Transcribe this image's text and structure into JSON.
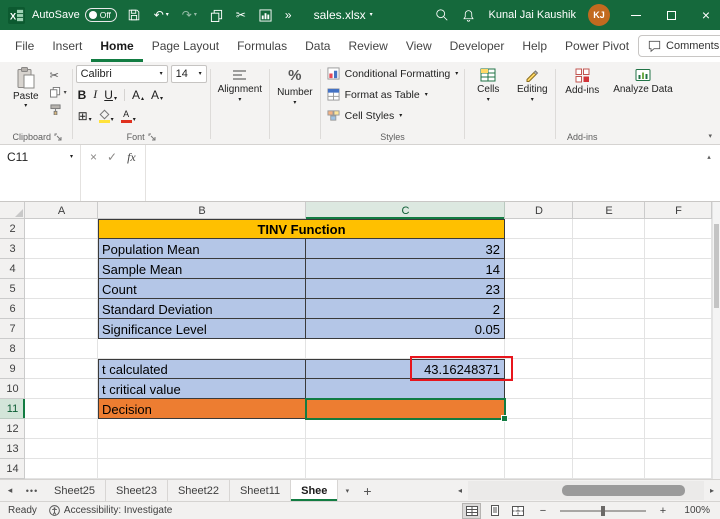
{
  "title_bar": {
    "autosave_label": "AutoSave",
    "autosave_state": "Off",
    "filename": "sales.xlsx",
    "user_name": "Kunal Jai Kaushik",
    "user_initials": "KJ"
  },
  "menu_bar": {
    "tabs": [
      {
        "label": "File",
        "active": false
      },
      {
        "label": "Insert",
        "active": false
      },
      {
        "label": "Home",
        "active": true
      },
      {
        "label": "Page Layout",
        "active": false
      },
      {
        "label": "Formulas",
        "active": false
      },
      {
        "label": "Data",
        "active": false
      },
      {
        "label": "Review",
        "active": false
      },
      {
        "label": "View",
        "active": false
      },
      {
        "label": "Developer",
        "active": false
      },
      {
        "label": "Help",
        "active": false
      },
      {
        "label": "Power Pivot",
        "active": false
      }
    ],
    "comments_label": "Comments"
  },
  "ribbon": {
    "paste_label": "Paste",
    "clipboard_group_label": "Clipboard",
    "font_name": "Calibri",
    "font_size": "14",
    "bold": "B",
    "italic": "I",
    "underline": "U",
    "font_group_label": "Font",
    "alignment_label": "Alignment",
    "number_label": "Number",
    "number_icon": "%",
    "conditional_formatting_label": "Conditional Formatting",
    "format_as_table_label": "Format as Table",
    "cell_styles_label": "Cell Styles",
    "styles_group_label": "Styles",
    "cells_label": "Cells",
    "editing_label": "Editing",
    "add_ins_label": "Add-ins",
    "analyze_data_label": "Analyze Data",
    "add_ins_group_label": "Add-ins"
  },
  "formula_bar": {
    "name_box": "C11",
    "cancel": "×",
    "enter": "✓",
    "fx": "fx",
    "value": ""
  },
  "grid": {
    "column_headers": [
      "A",
      "B",
      "C",
      "D",
      "E",
      "F"
    ],
    "first_row": 2,
    "last_row": 14,
    "active_cell": "C11",
    "selected_column": "C",
    "selected_row": 11,
    "title_row": {
      "row": 2,
      "text": "TINV Function",
      "fill": "#FFC000"
    },
    "rows": [
      {
        "row": 3,
        "label": "Population Mean",
        "value": "32",
        "fill": "#B4C6E7"
      },
      {
        "row": 4,
        "label": "Sample Mean",
        "value": "14",
        "fill": "#B4C6E7"
      },
      {
        "row": 5,
        "label": "Count",
        "value": "23",
        "fill": "#B4C6E7"
      },
      {
        "row": 6,
        "label": "Standard Deviation",
        "value": "2",
        "fill": "#B4C6E7"
      },
      {
        "row": 7,
        "label": "Significance Level",
        "value": "0.05",
        "fill": "#B4C6E7"
      },
      {
        "row": 9,
        "label": "t calculated",
        "value": "43.16248371",
        "fill": "#B4C6E7",
        "highlighted": true
      },
      {
        "row": 10,
        "label": "t critical value",
        "value": "",
        "fill": "#B4C6E7"
      },
      {
        "row": 11,
        "label": "Decision",
        "value": "",
        "fill": "#ED7D31"
      }
    ],
    "colors": {
      "selection": "#127C42",
      "highlight_border": "#E8151C",
      "table_border": "#3A3A3A"
    }
  },
  "sheet_tabs": {
    "overflow_indicator": "•••",
    "tabs": [
      {
        "label": "Sheet25",
        "active": false
      },
      {
        "label": "Sheet23",
        "active": false
      },
      {
        "label": "Sheet22",
        "active": false
      },
      {
        "label": "Sheet11",
        "active": false
      },
      {
        "label": "Shee",
        "active": true
      }
    ]
  },
  "status_bar": {
    "mode": "Ready",
    "accessibility_label": "Accessibility: Investigate",
    "zoom_level": "100%"
  }
}
